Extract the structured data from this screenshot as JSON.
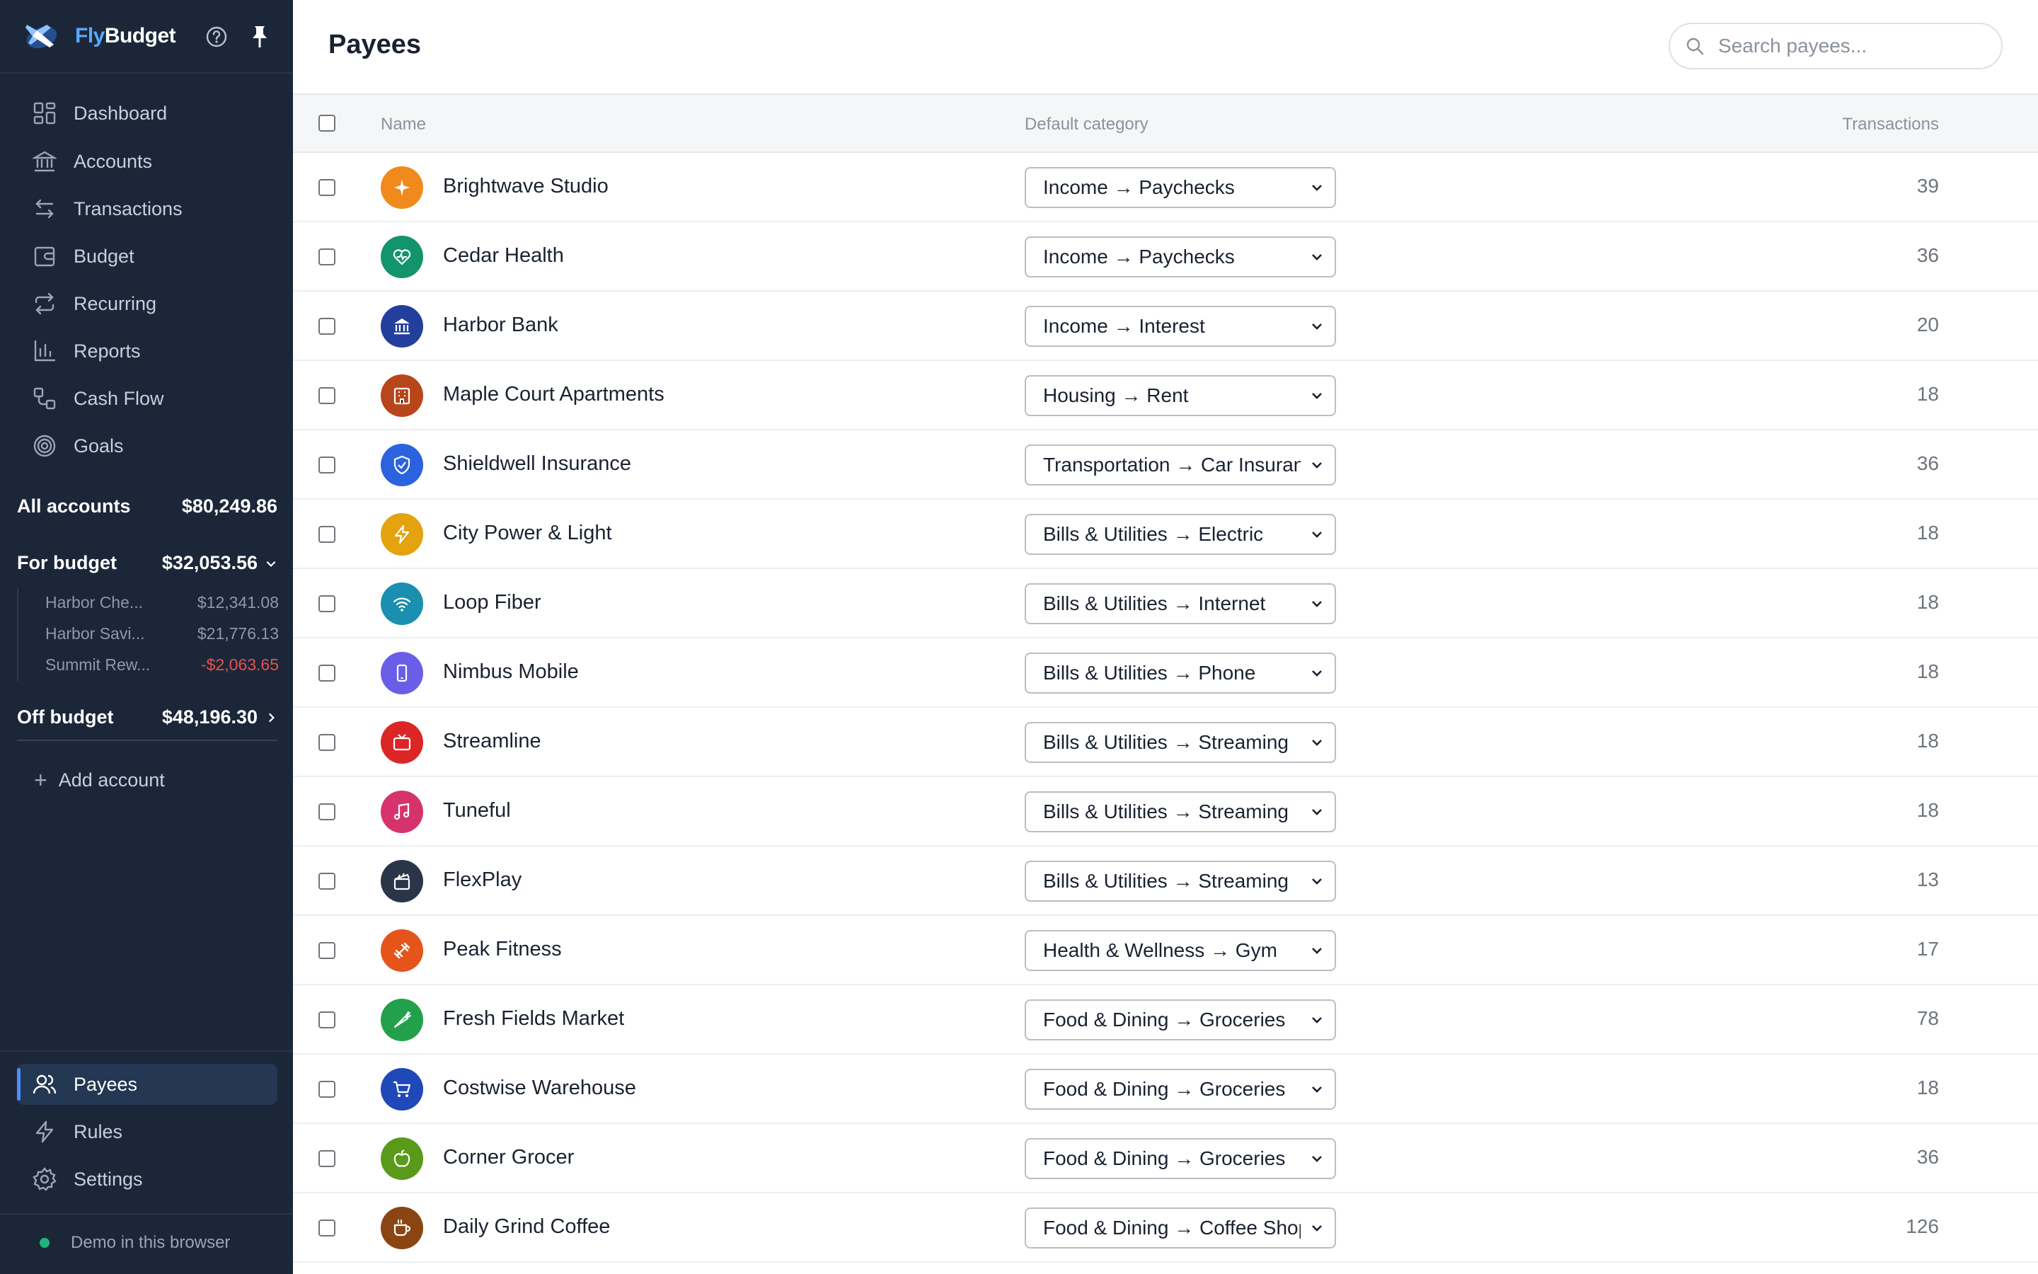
{
  "brand": {
    "prefix": "Fly",
    "suffix": "Budget"
  },
  "nav": [
    {
      "label": "Dashboard",
      "icon": "dashboard-icon"
    },
    {
      "label": "Accounts",
      "icon": "bank-icon"
    },
    {
      "label": "Transactions",
      "icon": "arrows-swap-icon"
    },
    {
      "label": "Budget",
      "icon": "wallet-icon"
    },
    {
      "label": "Recurring",
      "icon": "repeat-icon"
    },
    {
      "label": "Reports",
      "icon": "bar-chart-icon"
    },
    {
      "label": "Cash Flow",
      "icon": "flow-icon"
    },
    {
      "label": "Goals",
      "icon": "target-icon"
    }
  ],
  "accounts": {
    "all": {
      "label": "All accounts",
      "amount": "$80,249.86"
    },
    "for_budget": {
      "label": "For budget",
      "amount": "$32,053.56"
    },
    "sub": [
      {
        "name": "Harbor Che...",
        "amount": "$12,341.08"
      },
      {
        "name": "Harbor Savi...",
        "amount": "$21,776.13"
      },
      {
        "name": "Summit Rew...",
        "amount": "-$2,063.65"
      }
    ],
    "off_budget": {
      "label": "Off budget",
      "amount": "$48,196.30"
    },
    "add_label": "Add account"
  },
  "bottom_nav": [
    {
      "label": "Payees",
      "icon": "users-icon",
      "active": true
    },
    {
      "label": "Rules",
      "icon": "lightning-icon",
      "active": false
    },
    {
      "label": "Settings",
      "icon": "gear-icon",
      "active": false
    }
  ],
  "demo_label": "Demo in this browser",
  "page": {
    "title": "Payees",
    "search_placeholder": "Search payees..."
  },
  "columns": {
    "name": "Name",
    "category": "Default category",
    "transactions": "Transactions"
  },
  "colors": {
    "sidebar_bg": "#1b2738",
    "accent": "#4c8dff"
  },
  "payees": [
    {
      "name": "Brightwave Studio",
      "category": "Income → Paychecks",
      "count": "39",
      "color": "#f08a1c",
      "icon": "sparkle-icon"
    },
    {
      "name": "Cedar Health",
      "category": "Income → Paychecks",
      "count": "36",
      "color": "#13946b",
      "icon": "heart-icon"
    },
    {
      "name": "Harbor Bank",
      "category": "Income → Interest",
      "count": "20",
      "color": "#233f9c",
      "icon": "bank-icon"
    },
    {
      "name": "Maple Court Apartments",
      "category": "Housing → Rent",
      "count": "18",
      "color": "#b8461a",
      "icon": "building-icon"
    },
    {
      "name": "Shieldwell Insurance",
      "category": "Transportation → Car Insurance",
      "count": "36",
      "color": "#2c62e0",
      "icon": "shield-icon"
    },
    {
      "name": "City Power & Light",
      "category": "Bills & Utilities → Electric",
      "count": "18",
      "color": "#e3a20e",
      "icon": "bolt-icon"
    },
    {
      "name": "Loop Fiber",
      "category": "Bills & Utilities → Internet",
      "count": "18",
      "color": "#1a8fb0",
      "icon": "wifi-icon"
    },
    {
      "name": "Nimbus Mobile",
      "category": "Bills & Utilities → Phone",
      "count": "18",
      "color": "#6a5ee8",
      "icon": "phone-icon"
    },
    {
      "name": "Streamline",
      "category": "Bills & Utilities → Streaming",
      "count": "18",
      "color": "#dc2626",
      "icon": "tv-icon"
    },
    {
      "name": "Tuneful",
      "category": "Bills & Utilities → Streaming",
      "count": "18",
      "color": "#d6336c",
      "icon": "music-icon"
    },
    {
      "name": "FlexPlay",
      "category": "Bills & Utilities → Streaming",
      "count": "13",
      "color": "#2a3648",
      "icon": "clapper-icon"
    },
    {
      "name": "Peak Fitness",
      "category": "Health & Wellness → Gym",
      "count": "17",
      "color": "#e5541a",
      "icon": "dumbbell-icon"
    },
    {
      "name": "Fresh Fields Market",
      "category": "Food & Dining → Groceries",
      "count": "78",
      "color": "#22a04b",
      "icon": "carrot-icon"
    },
    {
      "name": "Costwise Warehouse",
      "category": "Food & Dining → Groceries",
      "count": "18",
      "color": "#1f49b8",
      "icon": "cart-icon"
    },
    {
      "name": "Corner Grocer",
      "category": "Food & Dining → Groceries",
      "count": "36",
      "color": "#5a9a1a",
      "icon": "apple-icon"
    },
    {
      "name": "Daily Grind Coffee",
      "category": "Food & Dining → Coffee Shops",
      "count": "126",
      "color": "#8a4512",
      "icon": "coffee-icon"
    }
  ]
}
